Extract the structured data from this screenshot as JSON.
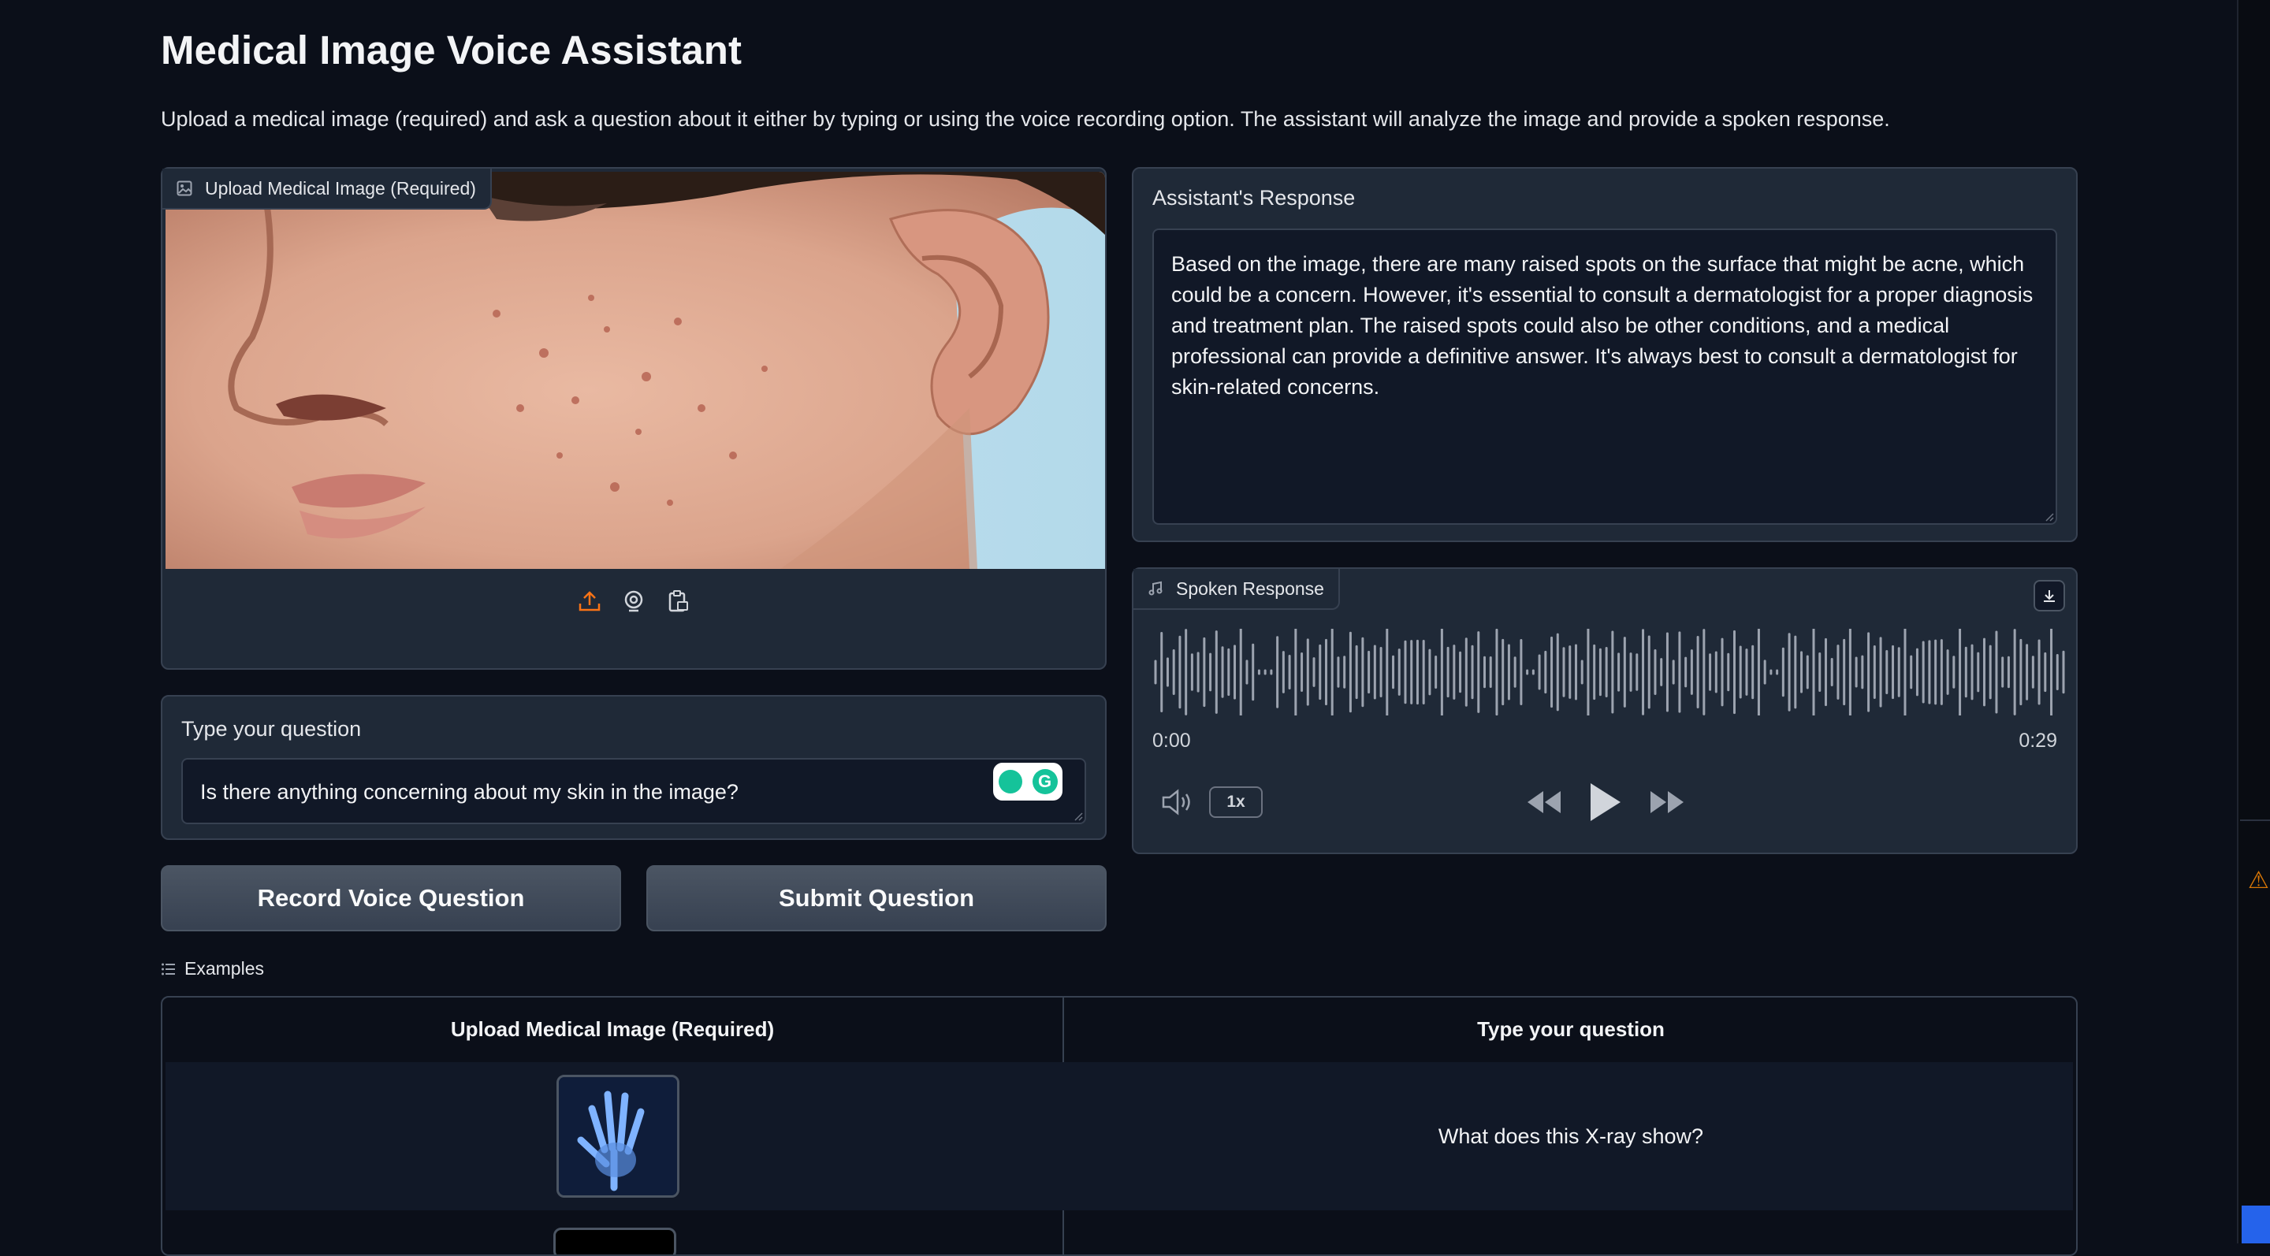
{
  "page": {
    "title": "Medical Image Voice Assistant",
    "description": "Upload a medical image (required) and ask a question about it either by typing or using the voice recording option. The assistant will analyze the image and provide a spoken response."
  },
  "image_input": {
    "label": "Upload Medical Image (Required)",
    "image_icon": "image-icon",
    "close_icon": "close-icon",
    "sources": [
      "upload-icon",
      "webcam-icon",
      "clipboard-icon"
    ]
  },
  "question": {
    "label": "Type your question",
    "value": "Is there anything concerning about my skin in the image?"
  },
  "buttons": {
    "record": "Record Voice Question",
    "submit": "Submit Question"
  },
  "response": {
    "label": "Assistant's Response",
    "text": "Based on the image, there are many raised spots on the surface that might be acne, which could be a concern. However, it's essential to consult a dermatologist for a proper diagnosis and treatment plan. The raised spots could also be other conditions, and a medical professional can provide a definitive answer. It's always best to consult a dermatologist for skin-related concerns."
  },
  "audio": {
    "label": "Spoken Response",
    "current_time": "0:00",
    "duration": "0:29",
    "speed": "1x",
    "playback_progress": 0
  },
  "examples": {
    "label": "Examples",
    "headers": [
      "Upload Medical Image (Required)",
      "Type your question"
    ],
    "rows": [
      {
        "question": "What does this X-ray show?"
      }
    ]
  },
  "colors": {
    "background": "#0b0f19",
    "panel": "#1f2937",
    "border": "#374151",
    "accent_upload": "#f97316",
    "grammarly": "#15c39a"
  }
}
